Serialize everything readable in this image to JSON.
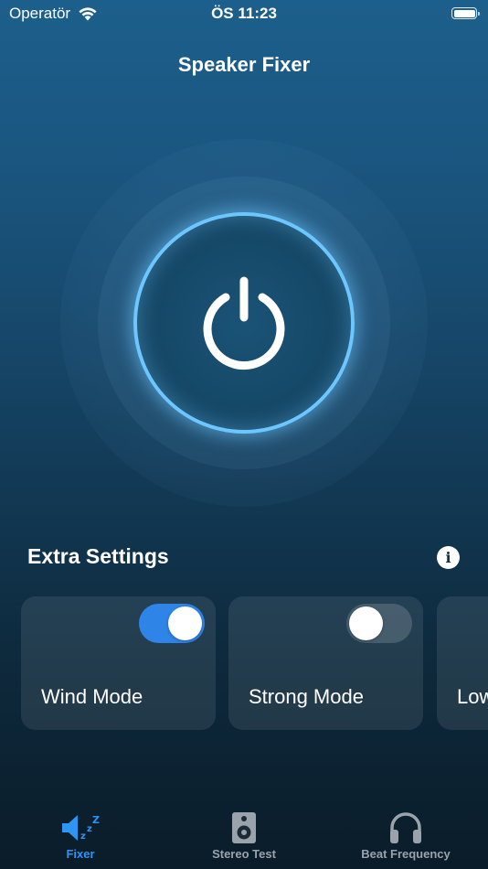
{
  "status_bar": {
    "carrier": "Operatör",
    "time": "ÖS 11:23",
    "battery_level": 1.0
  },
  "header": {
    "title": "Speaker Fixer"
  },
  "power_button": {
    "icon": "power-icon",
    "ring_color": "#6ec6ff"
  },
  "extra_settings": {
    "title": "Extra Settings",
    "info_icon": "info-icon",
    "info_glyph": "i",
    "cards": [
      {
        "label": "Wind Mode",
        "enabled": true
      },
      {
        "label": "Strong Mode",
        "enabled": false
      },
      {
        "label": "Low",
        "enabled": false
      }
    ]
  },
  "tab_bar": {
    "active_color": "#2f95f3",
    "inactive_color": "#9aa3ab",
    "tabs": [
      {
        "label": "Fixer",
        "icon": "speaker-sleep-icon",
        "active": true
      },
      {
        "label": "Stereo Test",
        "icon": "speaker-box-icon",
        "active": false
      },
      {
        "label": "Beat Frequency",
        "icon": "headphones-icon",
        "active": false
      }
    ]
  }
}
